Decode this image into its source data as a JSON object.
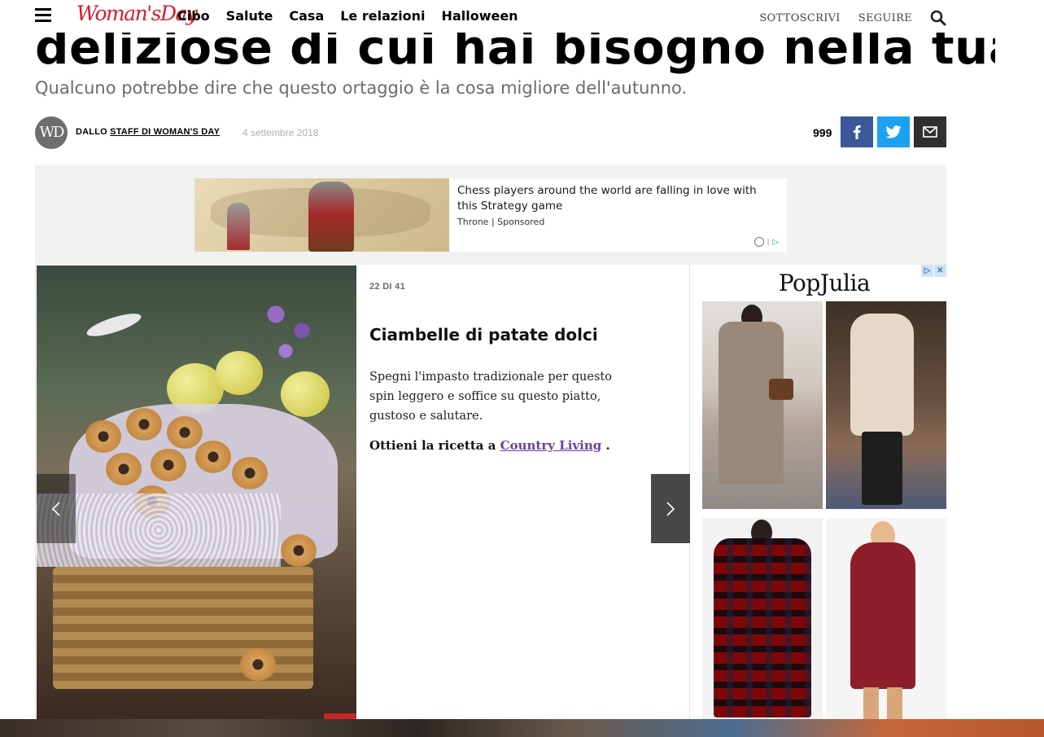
{
  "article": {
    "headline": "deliziose di cui hai bisogno nella tua vita",
    "subtitle": "Qualcuno potrebbe dire che questo ortaggio è la cosa migliore dell'autunno."
  },
  "nav": {
    "logo": "Woman'sDay",
    "links": [
      "Cibo",
      "Salute",
      "Casa",
      "Le relazioni",
      "Halloween"
    ],
    "subscribe": "SOTTOSCRIVI",
    "follow": "SEGUIRE"
  },
  "byline": {
    "avatar": "WD",
    "prefix": "DALLO",
    "author": "STAFF DI WOMAN'S DAY",
    "date": "4 settembre 2018",
    "share_count": "999"
  },
  "icons": {
    "menu": "hamburger-icon",
    "search": "search-icon",
    "facebook": "facebook-icon",
    "twitter": "twitter-icon",
    "email": "email-icon",
    "prev": "chevron-left-icon",
    "next": "chevron-right-icon",
    "adchoices": "adchoices-icon"
  },
  "colors": {
    "brand_red": "#d81b2c",
    "facebook": "#3b5998",
    "twitter": "#1da1f2",
    "link_purple": "#6c3f9a"
  },
  "ad_banner": {
    "title": "Chess players around the world are falling in love with this Strategy game",
    "sponsor": "Throne | Sponsored"
  },
  "slide": {
    "counter": "22 DI 41",
    "title": "Ciambelle di patate dolci",
    "body": "Spegni l'impasto tradizionale per questo spin leggero e soffice su questo piatto, gustoso e salutare.",
    "cta_prefix": "Ottieni la ricetta a",
    "cta_link": "Country Living",
    "cta_suffix": "."
  },
  "side_ad": {
    "brand": "PopJulia",
    "flag_info": "▷",
    "flag_close": "✕"
  }
}
